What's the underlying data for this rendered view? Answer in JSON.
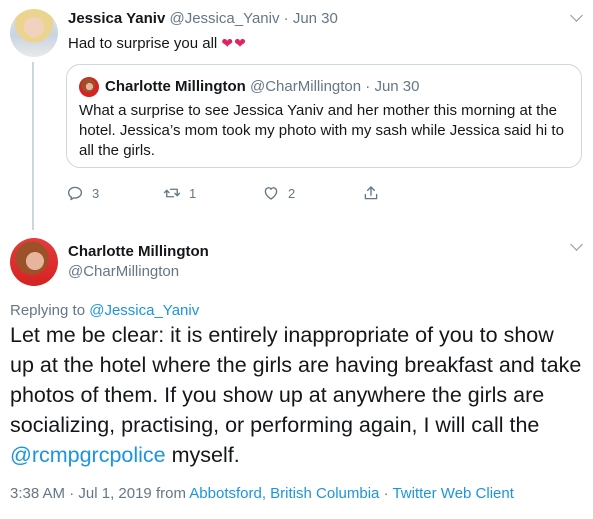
{
  "tweet1": {
    "name": "Jessica Yaniv",
    "handle": "@Jessica_Yaniv",
    "separator": "·",
    "date": "Jun 30",
    "text": "Had to surprise you all",
    "emoji": "❤❤",
    "quote": {
      "name": "Charlotte Millington",
      "handle": "@CharMillington",
      "separator": "·",
      "date": "Jun 30",
      "text": "What a surprise to see Jessica Yaniv and her mother this morning at the hotel. Jessica’s mom took my photo with my sash while Jessica said hi to all the girls."
    },
    "actions": {
      "reply_count": "3",
      "retweet_count": "1",
      "like_count": "2"
    }
  },
  "tweet2": {
    "name": "Charlotte Millington",
    "handle": "@CharMillington",
    "replying_prefix": "Replying to",
    "replying_to": "@Jessica_Yaniv",
    "text_before_mention": "Let me be clear: it is entirely inappropriate of you to show up at the hotel where the girls are having breakfast and take photos of them. If you show up at anywhere the girls are socializing, practising, or performing again, I will call the ",
    "mention": "@rcmpgrcpolice",
    "text_after_mention": " myself.",
    "time": "3:38 AM",
    "meta_sep1": "·",
    "date": "Jul 1, 2019",
    "from_label": "from",
    "location": "Abbotsford, British Columbia",
    "meta_sep2": "·",
    "client": "Twitter Web Client"
  },
  "colors": {
    "text": "#14171a",
    "muted": "#657786",
    "link": "#1b95e0",
    "border": "#ccd6dd",
    "heart": "#e0245e"
  },
  "icons": [
    "reply-icon",
    "retweet-icon",
    "like-icon",
    "share-icon",
    "chevron-down-icon"
  ]
}
